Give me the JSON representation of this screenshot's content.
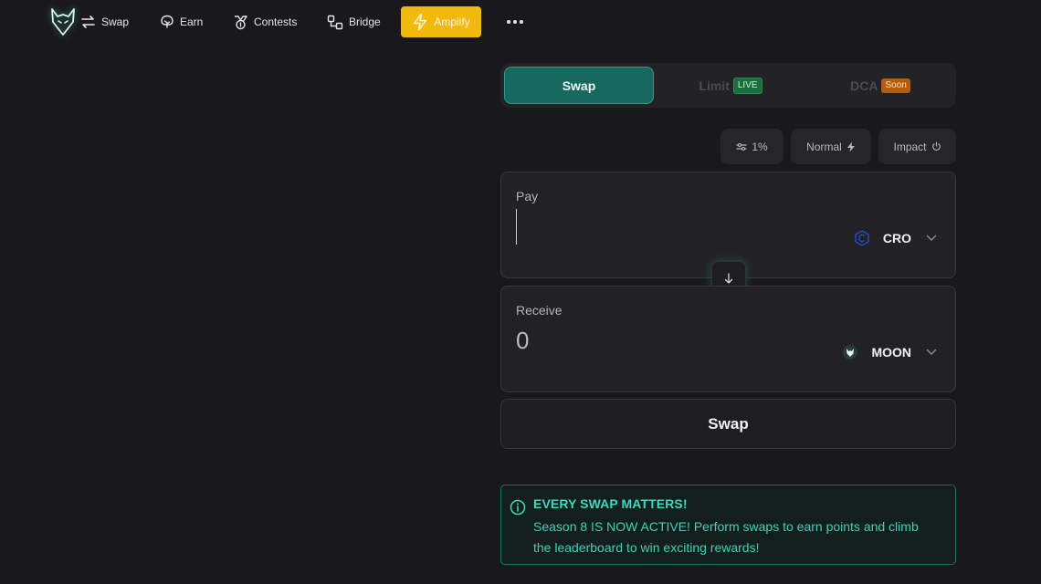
{
  "nav": {
    "items": [
      {
        "id": "swap",
        "label": "Swap",
        "icon": "arrows-swap-icon"
      },
      {
        "id": "earn",
        "label": "Earn",
        "icon": "tree-icon"
      },
      {
        "id": "contests",
        "label": "Contests",
        "icon": "medal-icon"
      },
      {
        "id": "bridge",
        "label": "Bridge",
        "icon": "bridge-nodes-icon"
      }
    ],
    "amplify_label": "Amplify",
    "more_icon": "more-dots-icon",
    "logo_icon": "wolf-logo-icon"
  },
  "mode_tabs": {
    "swap": "Swap",
    "limit": "Limit",
    "limit_badge": "LIVE",
    "dca": "DCA",
    "dca_badge": "Soon"
  },
  "settings": {
    "slippage": "1%",
    "speed": "Normal",
    "impact": "Impact"
  },
  "pay": {
    "label": "Pay",
    "amount": "",
    "token": "CRO"
  },
  "receive": {
    "label": "Receive",
    "amount": "0",
    "token": "MOON"
  },
  "swap_button": "Swap",
  "notice": {
    "title": "EVERY SWAP MATTERS!",
    "body": "Season 8 IS NOW ACTIVE! Perform swaps to earn points and climb the leaderboard to win exciting rewards!"
  },
  "colors": {
    "background": "#19191b",
    "accent_teal": "#17685e",
    "amplify_yellow": "#f0b90b",
    "notice_text": "#3fd8bd"
  }
}
